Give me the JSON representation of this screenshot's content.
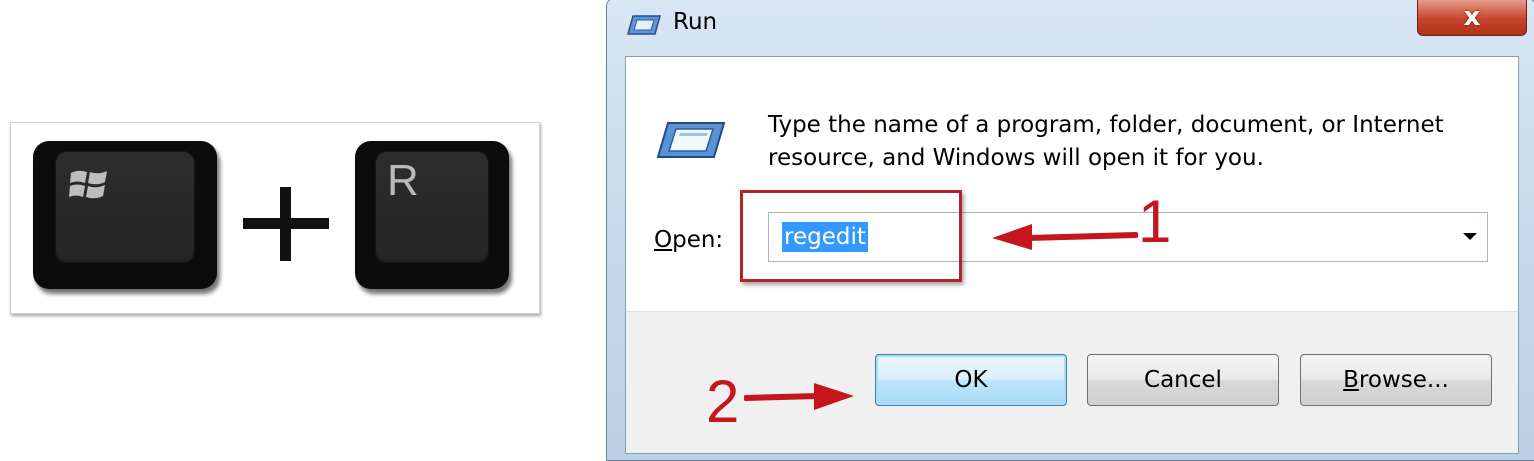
{
  "keyboard_shortcut": {
    "key1_icon": "windows-logo-icon",
    "plus": "+",
    "key2_label": "R"
  },
  "dialog": {
    "title": "Run",
    "close_label": "x",
    "description": "Type the name of a program, folder, document, or Internet resource, and Windows will open it for you.",
    "open_label_access": "O",
    "open_label_rest": "pen:",
    "open_value": "regedit",
    "buttons": {
      "ok": "OK",
      "cancel": "Cancel",
      "browse_access": "B",
      "browse_rest": "rowse..."
    }
  },
  "annotations": {
    "step1": "1",
    "step2": "2",
    "color": "#c4161c"
  }
}
